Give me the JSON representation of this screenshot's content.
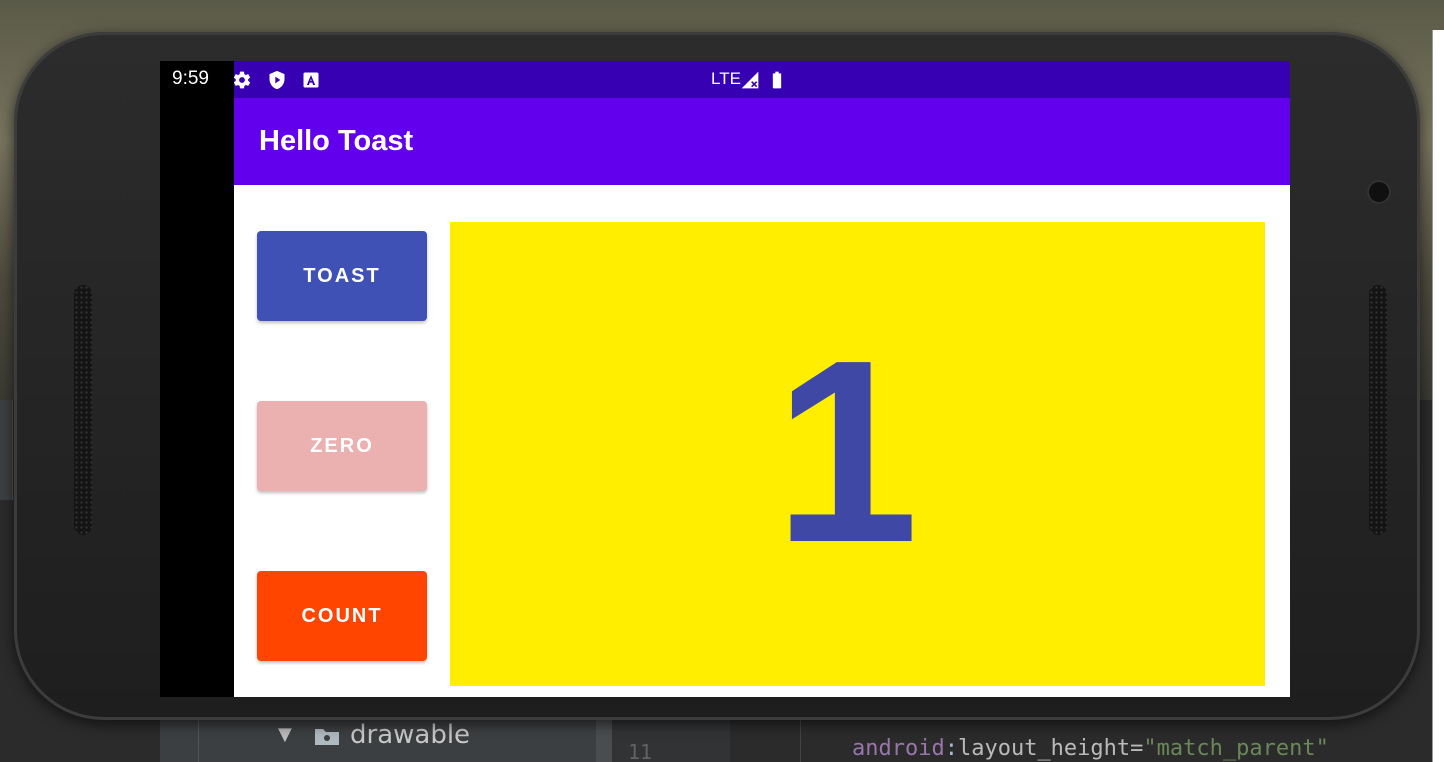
{
  "status_bar": {
    "time": "9:59",
    "network": "LTE",
    "icons": [
      "gear-icon",
      "shield-icon",
      "accessibility-icon",
      "signal-icon",
      "battery-icon"
    ],
    "background_color": "#3700b3"
  },
  "app_bar": {
    "title": "Hello Toast",
    "background_color": "#6200ee"
  },
  "buttons": {
    "toast": {
      "label": "TOAST",
      "color": "#3f51b5"
    },
    "zero": {
      "label": "ZERO",
      "color": "#ebb1b1"
    },
    "count": {
      "label": "COUNT",
      "color": "#ff4500"
    }
  },
  "counter": {
    "value": "1",
    "background_color": "#ffee00",
    "text_color": "#3f48a5"
  },
  "ide": {
    "tree": {
      "folder_label": "drawable"
    },
    "editor": {
      "line_number": "11",
      "code_ns": "android",
      "code_sep": ":",
      "code_attr": "layout_height=",
      "code_value": "\"match_parent\""
    }
  }
}
